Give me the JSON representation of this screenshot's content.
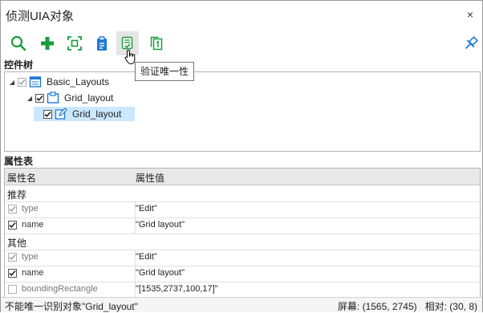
{
  "window": {
    "title": "侦测UIA对象",
    "close_glyph": "×"
  },
  "toolbar": {
    "buttons": [
      "search-icon",
      "add-icon",
      "capture-icon",
      "clipboard-icon",
      "verify-icon",
      "copy-index-icon"
    ],
    "pin": "pin-icon",
    "tooltip": "验证唯一性"
  },
  "tree": {
    "label": "控件树",
    "nodes": [
      {
        "label": "Basic_Layouts",
        "checked": true,
        "dim": true,
        "expanded": true,
        "icon": "window-icon"
      },
      {
        "label": "Grid_layout",
        "checked": true,
        "dim": false,
        "expanded": true,
        "icon": "grid-icon"
      },
      {
        "label": "Grid_layout",
        "checked": true,
        "dim": false,
        "selected": true,
        "icon": "edit-icon"
      }
    ]
  },
  "props": {
    "label": "属性表",
    "col_name": "属性名",
    "col_value": "属性值",
    "groups": [
      {
        "name": "推荐",
        "rows": [
          {
            "name": "type",
            "value": "\"Edit\"",
            "checked": true,
            "dim": true
          },
          {
            "name": "name",
            "value": "\"Grid layout\"",
            "checked": true,
            "dim": false
          }
        ]
      },
      {
        "name": "其他",
        "rows": [
          {
            "name": "type",
            "value": "\"Edit\"",
            "checked": true,
            "dim": true
          },
          {
            "name": "name",
            "value": "\"Grid layout\"",
            "checked": true,
            "dim": false
          },
          {
            "name": "boundingRectangle",
            "value": "\"[1535,2737,100,17]\"",
            "checked": false,
            "dim": true
          }
        ]
      }
    ]
  },
  "status": {
    "message": "不能唯一识别对象\"Grid_layout\"",
    "screen": "屏幕: (1565, 2745)",
    "relative": "相对: (30, 8)"
  },
  "colors": {
    "accent_green": "#1a9c3a",
    "accent_blue": "#1e78d7",
    "selection": "#cce8ff"
  }
}
